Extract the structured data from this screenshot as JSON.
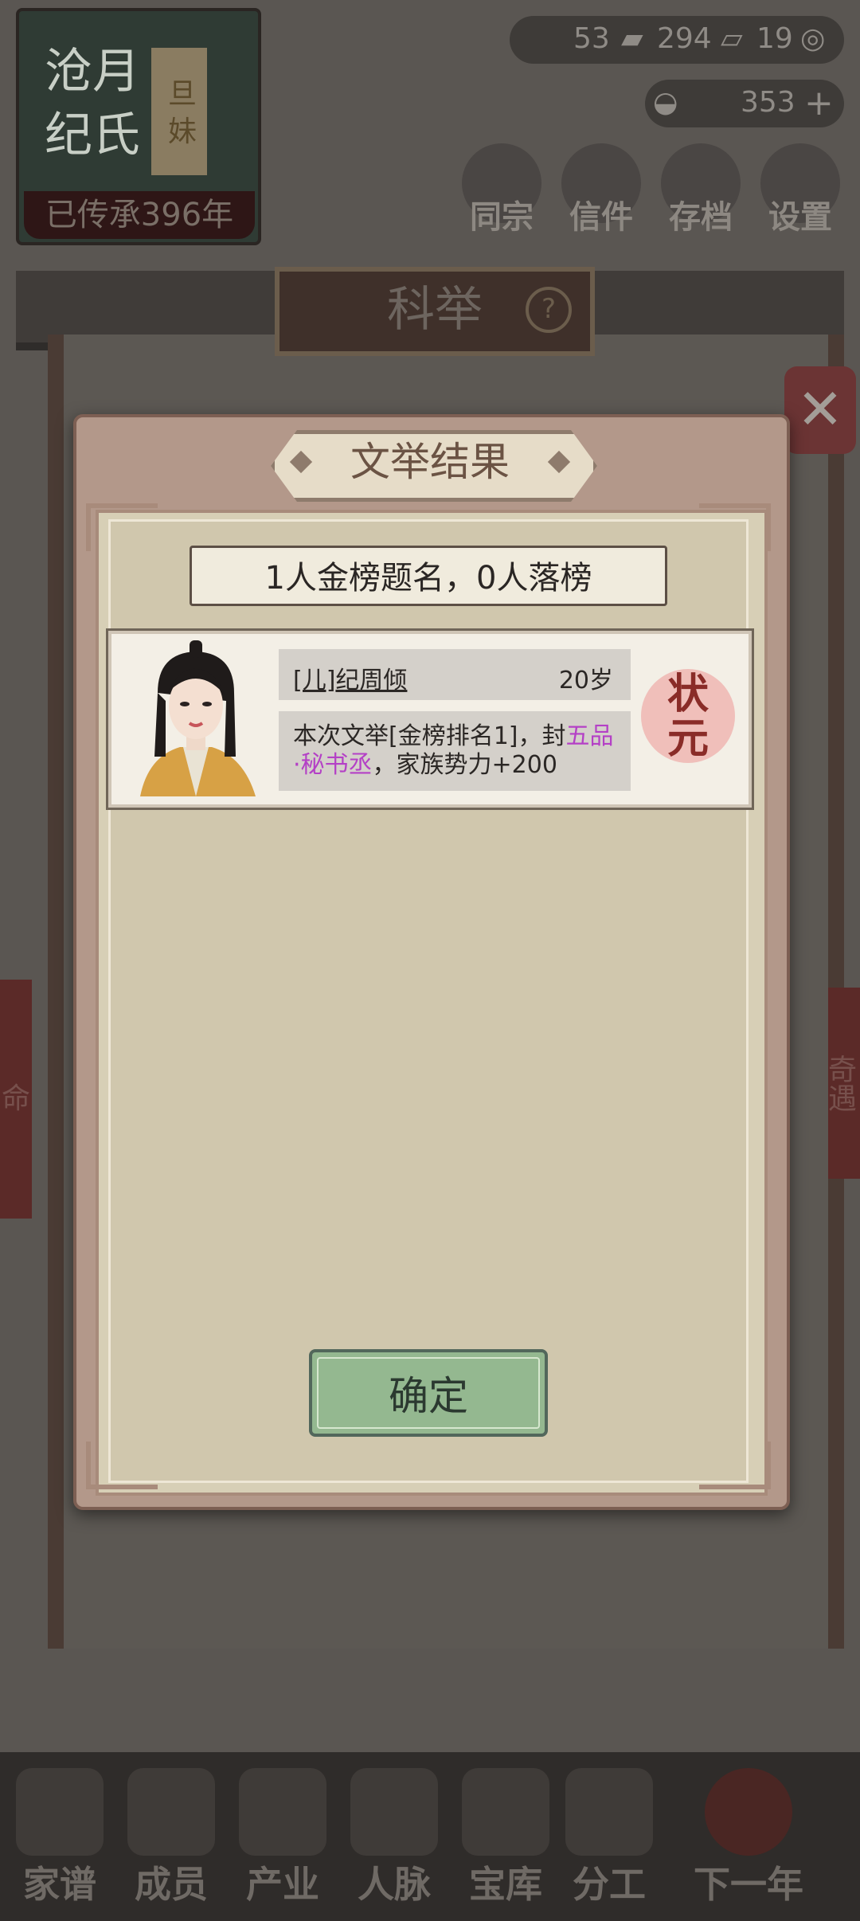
{
  "background": {
    "family_banner": {
      "name": "沧月 纪氏",
      "flag": "旦 妹",
      "heritage": "已传承396年"
    },
    "resources": {
      "silver": "53",
      "ticket": "294",
      "coin": "19",
      "gold": "353"
    },
    "top_menu": [
      "同宗",
      "信件",
      "存档",
      "设置"
    ],
    "section_title": "科举",
    "help_label": "?",
    "close_label": "✕",
    "side_left": "命",
    "side_right": "奇遇",
    "bottom_nav": [
      "家谱",
      "成员",
      "产业",
      "人脉",
      "宝库",
      "分工",
      "下一年"
    ]
  },
  "dialog": {
    "title": "文举结果",
    "summary": "1人金榜题名，0人落榜",
    "results": [
      {
        "relation": "[儿]",
        "name": "纪周倾",
        "age": "20岁",
        "desc_prefix": "本次文举[金榜排名1]，封",
        "desc_highlight": "五品·秘书丞",
        "desc_suffix": "，家族势力+200",
        "stamp_line1": "状",
        "stamp_line2": "元"
      }
    ],
    "confirm_label": "确定"
  },
  "colors": {
    "highlight": "#b440c6",
    "confirm_bg": "#94b890",
    "dialog_frame": "#b3988a"
  }
}
